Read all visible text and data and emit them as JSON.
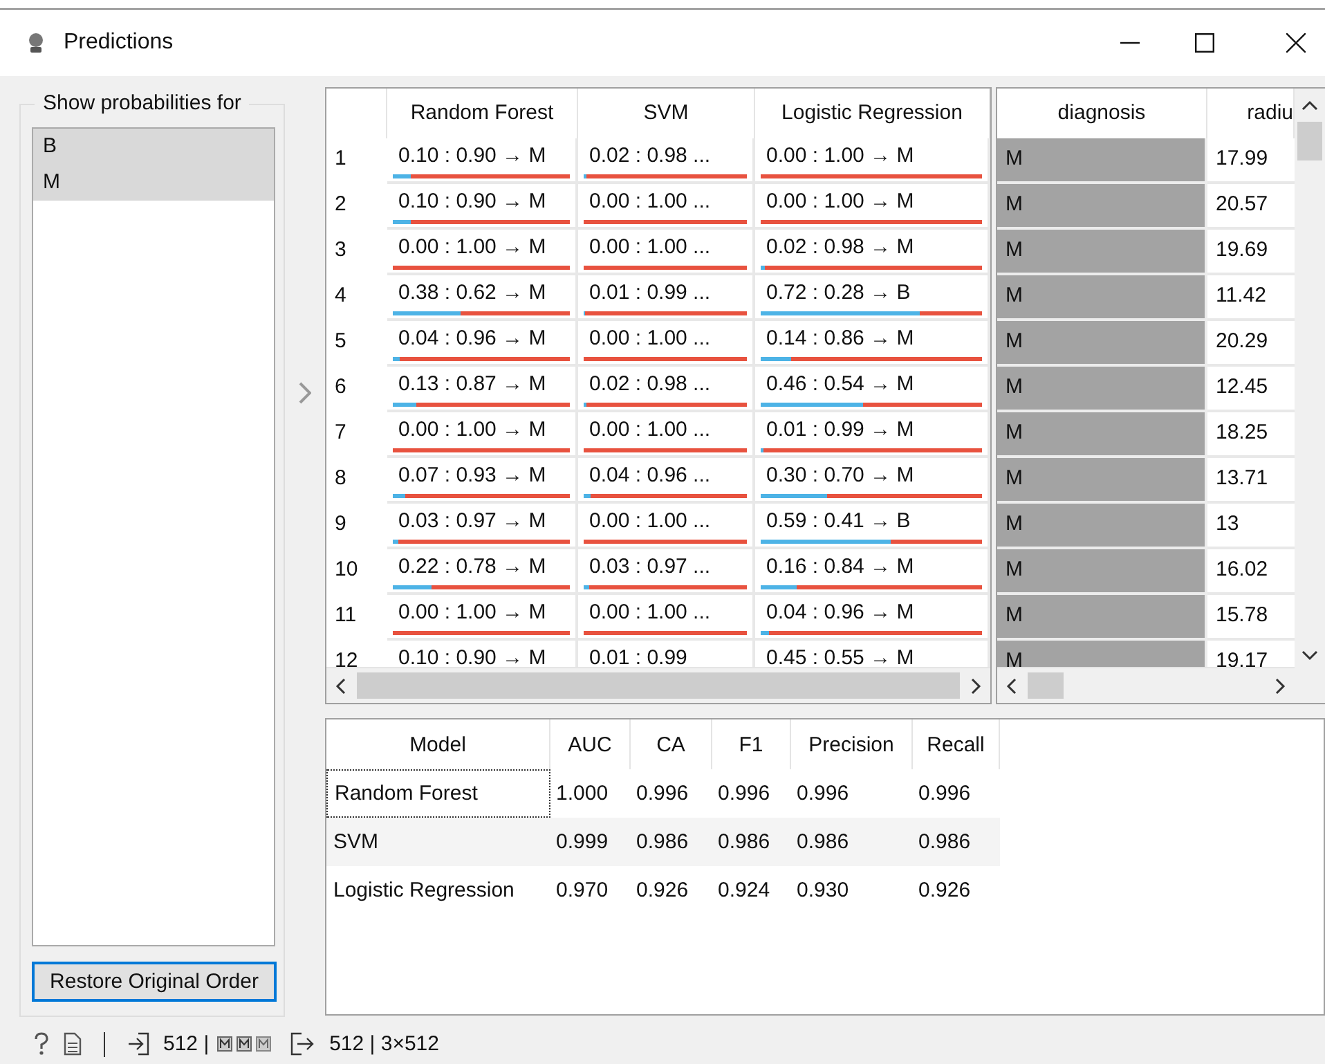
{
  "window": {
    "title": "Predictions"
  },
  "class_panel": {
    "title": "Show probabilities for",
    "items": [
      {
        "label": "B",
        "selected": true
      },
      {
        "label": "M",
        "selected": true
      }
    ],
    "button": "Restore Original Order"
  },
  "predictions": {
    "columns": [
      "Random Forest",
      "SVM",
      "Logistic Regression"
    ],
    "rows": [
      {
        "index": "1",
        "cells": [
          {
            "text": "0.10 : 0.90 → M",
            "level": 0.1
          },
          {
            "text": "0.02 : 0.98 ...",
            "level": 0.02
          },
          {
            "text": "0.00 : 1.00 → M",
            "level": 0.0
          }
        ]
      },
      {
        "index": "2",
        "cells": [
          {
            "text": "0.10 : 0.90 → M",
            "level": 0.1
          },
          {
            "text": "0.00 : 1.00 ...",
            "level": 0.0
          },
          {
            "text": "0.00 : 1.00 → M",
            "level": 0.0
          }
        ]
      },
      {
        "index": "3",
        "cells": [
          {
            "text": "0.00 : 1.00 → M",
            "level": 0.0
          },
          {
            "text": "0.00 : 1.00 ...",
            "level": 0.0
          },
          {
            "text": "0.02 : 0.98 → M",
            "level": 0.02
          }
        ]
      },
      {
        "index": "4",
        "cells": [
          {
            "text": "0.38 : 0.62 → M",
            "level": 0.38
          },
          {
            "text": "0.01 : 0.99 ...",
            "level": 0.01
          },
          {
            "text": "0.72 : 0.28 → B",
            "level": 0.72
          }
        ]
      },
      {
        "index": "5",
        "cells": [
          {
            "text": "0.04 : 0.96 → M",
            "level": 0.04
          },
          {
            "text": "0.00 : 1.00 ...",
            "level": 0.0
          },
          {
            "text": "0.14 : 0.86 → M",
            "level": 0.14
          }
        ]
      },
      {
        "index": "6",
        "cells": [
          {
            "text": "0.13 : 0.87 → M",
            "level": 0.13
          },
          {
            "text": "0.02 : 0.98 ...",
            "level": 0.02
          },
          {
            "text": "0.46 : 0.54 → M",
            "level": 0.46
          }
        ]
      },
      {
        "index": "7",
        "cells": [
          {
            "text": "0.00 : 1.00 → M",
            "level": 0.0
          },
          {
            "text": "0.00 : 1.00 ...",
            "level": 0.0
          },
          {
            "text": "0.01 : 0.99 → M",
            "level": 0.01
          }
        ]
      },
      {
        "index": "8",
        "cells": [
          {
            "text": "0.07 : 0.93 → M",
            "level": 0.07
          },
          {
            "text": "0.04 : 0.96 ...",
            "level": 0.04
          },
          {
            "text": "0.30 : 0.70 → M",
            "level": 0.3
          }
        ]
      },
      {
        "index": "9",
        "cells": [
          {
            "text": "0.03 : 0.97 → M",
            "level": 0.03
          },
          {
            "text": "0.00 : 1.00 ...",
            "level": 0.0
          },
          {
            "text": "0.59 : 0.41 → B",
            "level": 0.59
          }
        ]
      },
      {
        "index": "10",
        "cells": [
          {
            "text": "0.22 : 0.78 → M",
            "level": 0.22
          },
          {
            "text": "0.03 : 0.97 ...",
            "level": 0.03
          },
          {
            "text": "0.16 : 0.84 → M",
            "level": 0.16
          }
        ]
      },
      {
        "index": "11",
        "cells": [
          {
            "text": "0.00 : 1.00 → M",
            "level": 0.0
          },
          {
            "text": "0.00 : 1.00 ...",
            "level": 0.0
          },
          {
            "text": "0.04 : 0.96 → M",
            "level": 0.04
          }
        ]
      },
      {
        "index": "12",
        "cells": [
          {
            "text": "0.10 : 0.90 → M"
          },
          {
            "text": "0.01 : 0.99"
          },
          {
            "text": "0.45 : 0.55 → M"
          }
        ]
      }
    ]
  },
  "data_table": {
    "columns": [
      "diagnosis",
      "radiu"
    ],
    "rows": [
      [
        "M",
        "17.99"
      ],
      [
        "M",
        "20.57"
      ],
      [
        "M",
        "19.69"
      ],
      [
        "M",
        "11.42"
      ],
      [
        "M",
        "20.29"
      ],
      [
        "M",
        "12.45"
      ],
      [
        "M",
        "18.25"
      ],
      [
        "M",
        "13.71"
      ],
      [
        "M",
        "13"
      ],
      [
        "M",
        "16.02"
      ],
      [
        "M",
        "15.78"
      ],
      [
        "M",
        "19.17"
      ]
    ]
  },
  "scores": {
    "columns": [
      "Model",
      "AUC",
      "CA",
      "F1",
      "Precision",
      "Recall"
    ],
    "rows": [
      {
        "cells": [
          "Random Forest",
          "1.000",
          "0.996",
          "0.996",
          "0.996",
          "0.996"
        ],
        "focused": true
      },
      {
        "cells": [
          "SVM",
          "0.999",
          "0.986",
          "0.986",
          "0.986",
          "0.986"
        ],
        "focused": false
      },
      {
        "cells": [
          "Logistic Regression",
          "0.970",
          "0.926",
          "0.924",
          "0.930",
          "0.926"
        ],
        "focused": false
      }
    ]
  },
  "status_bar": {
    "input": "512 |",
    "output": "512 | 3×512"
  }
}
